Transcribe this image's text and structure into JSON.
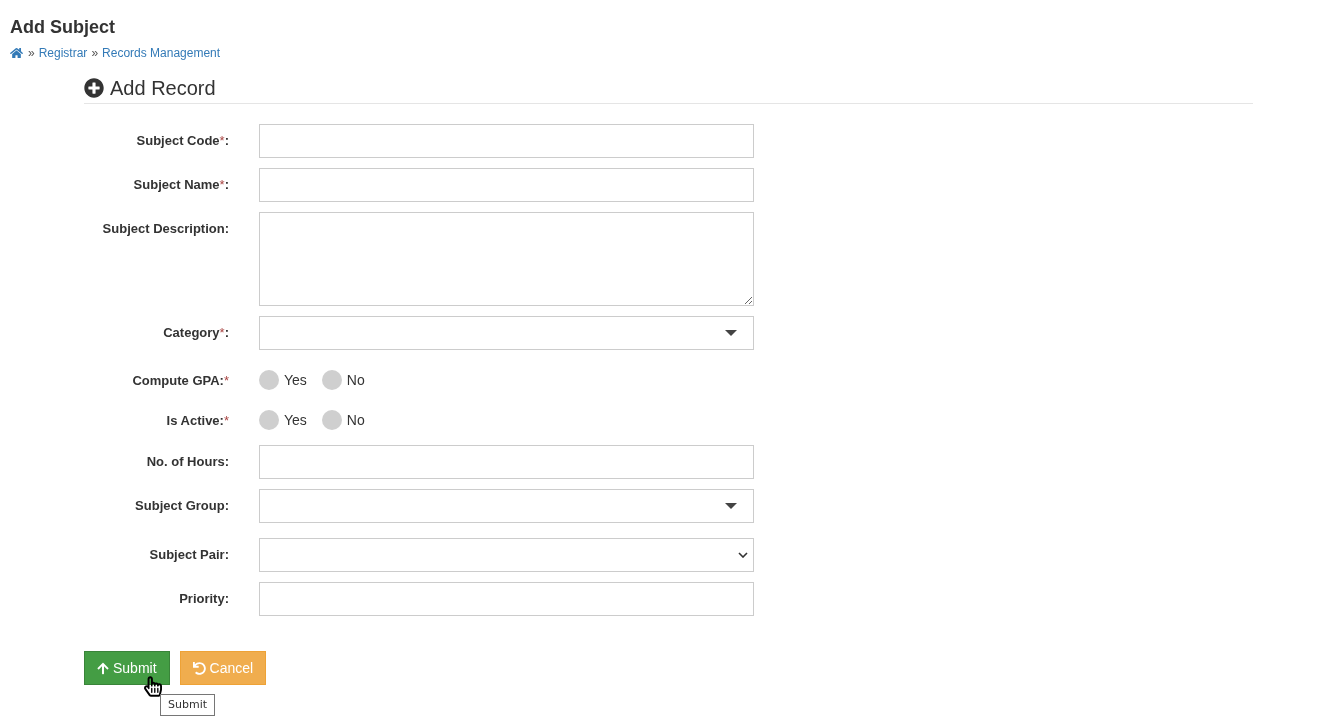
{
  "page": {
    "title": "Add Subject"
  },
  "breadcrumb": [
    {
      "kind": "home"
    },
    {
      "kind": "separator",
      "text": "»"
    },
    {
      "kind": "link",
      "text": "Registrar"
    },
    {
      "kind": "separator",
      "text": "»"
    },
    {
      "kind": "link",
      "text": "Records Management"
    }
  ],
  "section": {
    "title": "Add Record"
  },
  "fields": [
    {
      "kind": "text",
      "label": "Subject Code",
      "required_mark": "*",
      "label_tail": ":"
    },
    {
      "kind": "text",
      "label": "Subject Name",
      "required_mark": "*",
      "label_tail": ":"
    },
    {
      "kind": "textarea",
      "label": "Subject Description:"
    },
    {
      "kind": "dropdown",
      "label": "Category",
      "required_mark": "*",
      "label_tail": ":"
    },
    {
      "kind": "radio",
      "label": "Compute GPA:",
      "required_mark": "*",
      "options": [
        {
          "label": "Yes",
          "selected": false
        },
        {
          "label": "No",
          "selected": false
        }
      ]
    },
    {
      "kind": "radio",
      "label": "Is Active:",
      "required_mark": "*",
      "options": [
        {
          "label": "Yes",
          "selected": false
        },
        {
          "label": "No",
          "selected": false
        }
      ]
    },
    {
      "kind": "text",
      "label": "No. of Hours:"
    },
    {
      "kind": "dropdown",
      "label": "Subject Group:"
    },
    {
      "kind": "select",
      "label": "Subject Pair:"
    },
    {
      "kind": "text",
      "label": "Priority:"
    }
  ],
  "buttons": [
    {
      "kind": "submit",
      "label": "Submit",
      "hovered": true,
      "tooltip": "Submit"
    },
    {
      "kind": "cancel",
      "label": "Cancel",
      "hovered": false
    }
  ]
}
